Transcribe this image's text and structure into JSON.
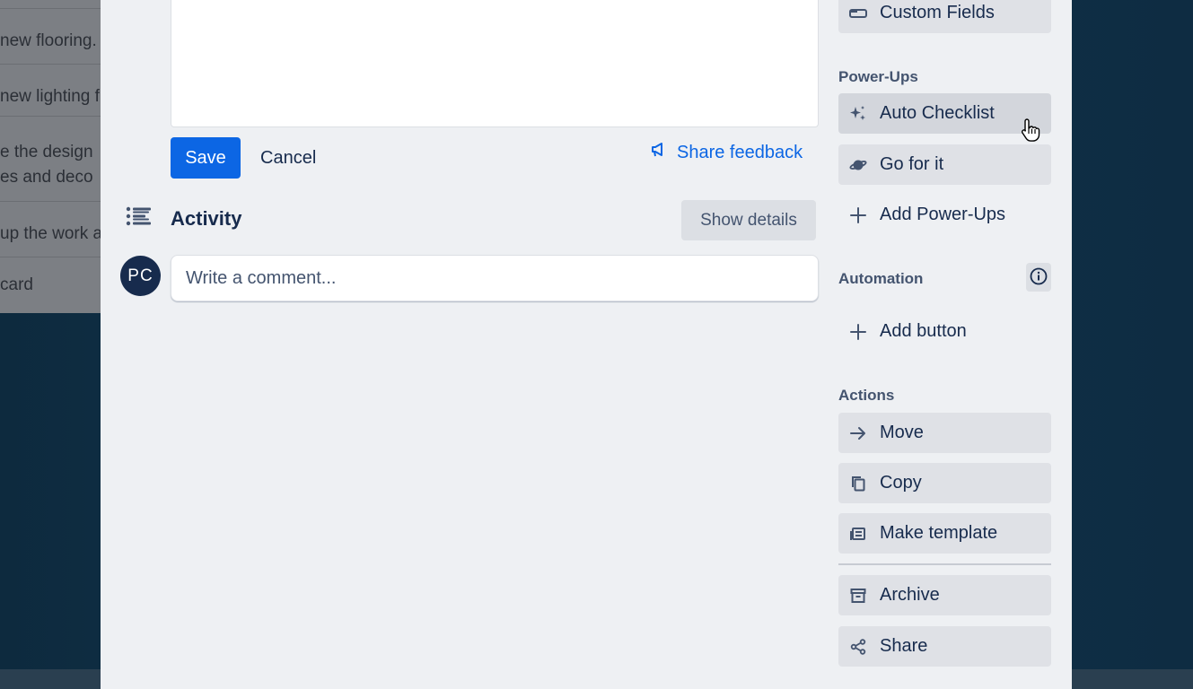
{
  "board": {
    "cards": [
      {
        "lines": [
          "new flooring."
        ]
      },
      {
        "lines": [
          "new lighting f"
        ]
      },
      {
        "lines": [
          "e the design",
          "es and deco"
        ]
      },
      {
        "lines": [
          "up the work a"
        ]
      },
      {
        "lines": [
          "card"
        ]
      }
    ]
  },
  "editor": {
    "save_label": "Save",
    "cancel_label": "Cancel",
    "share_feedback_label": "Share feedback"
  },
  "activity": {
    "title": "Activity",
    "show_details_label": "Show details",
    "avatar_initials": "PC",
    "comment_placeholder": "Write a comment..."
  },
  "sidebar": {
    "custom_fields_label": "Custom Fields",
    "power_ups_heading": "Power-Ups",
    "power_ups": [
      {
        "label": "Auto Checklist",
        "icon": "sparkle-icon"
      },
      {
        "label": "Go for it",
        "icon": "planet-icon"
      },
      {
        "label": "Add Power-Ups",
        "icon": "plus-icon"
      }
    ],
    "automation_heading": "Automation",
    "add_button_label": "Add button",
    "actions_heading": "Actions",
    "actions": [
      {
        "label": "Move",
        "icon": "arrow-right-icon"
      },
      {
        "label": "Copy",
        "icon": "copy-icon"
      },
      {
        "label": "Make template",
        "icon": "template-icon"
      },
      {
        "label": "Archive",
        "icon": "archive-icon"
      },
      {
        "label": "Share",
        "icon": "share-icon"
      }
    ]
  },
  "colors": {
    "primary": "#0c66e4",
    "text": "#172b4d",
    "subtle_text": "#44546f",
    "modal_bg": "#eef0f3",
    "button_bg": "#dfe1e6"
  }
}
